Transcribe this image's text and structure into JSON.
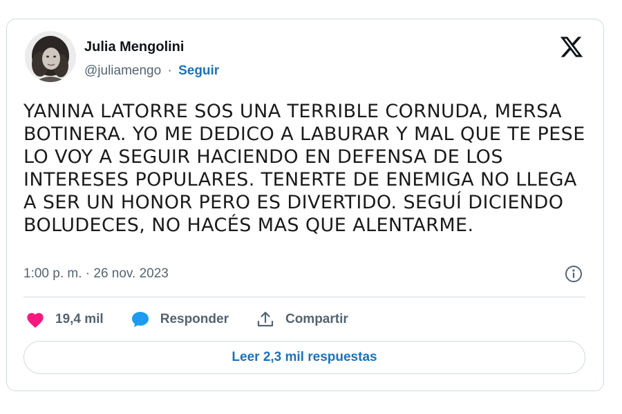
{
  "author": {
    "name": "Julia Mengolini",
    "handle": "@juliamengo",
    "separator": "·",
    "follow_label": "Seguir"
  },
  "tweet": {
    "text": "YANINA LATORRE SOS UNA TERRIBLE CORNUDA, MERSA BOTINERA. YO ME DEDICO A LABURAR Y MAL QUE TE PESE LO VOY A SEGUIR HACIENDO EN DEFENSA DE LOS INTERESES POPULARES. TENERTE DE ENEMIGA NO LLEGA A SER UN HONOR PERO ES DIVERTIDO. SEGUÍ DICIENDO BOLUDECES, NO HACÉS MAS QUE ALENTARME.",
    "timestamp": "1:00 p. m. · 26 nov. 2023"
  },
  "actions": {
    "likes_label": "19,4 mil",
    "reply_label": "Responder",
    "share_label": "Compartir"
  },
  "replies_button": {
    "label": "Leer 2,3 mil respuestas"
  },
  "icons": {
    "logo": "x-logo-icon",
    "info": "info-icon",
    "like": "heart-icon",
    "reply": "speech-bubble-icon",
    "share": "share-upload-icon"
  },
  "colors": {
    "heart": "#f91880",
    "reply_bubble": "#1d9bf0",
    "link_blue": "#1d71b8",
    "secondary_text": "#536471",
    "border": "#cfd9de"
  }
}
